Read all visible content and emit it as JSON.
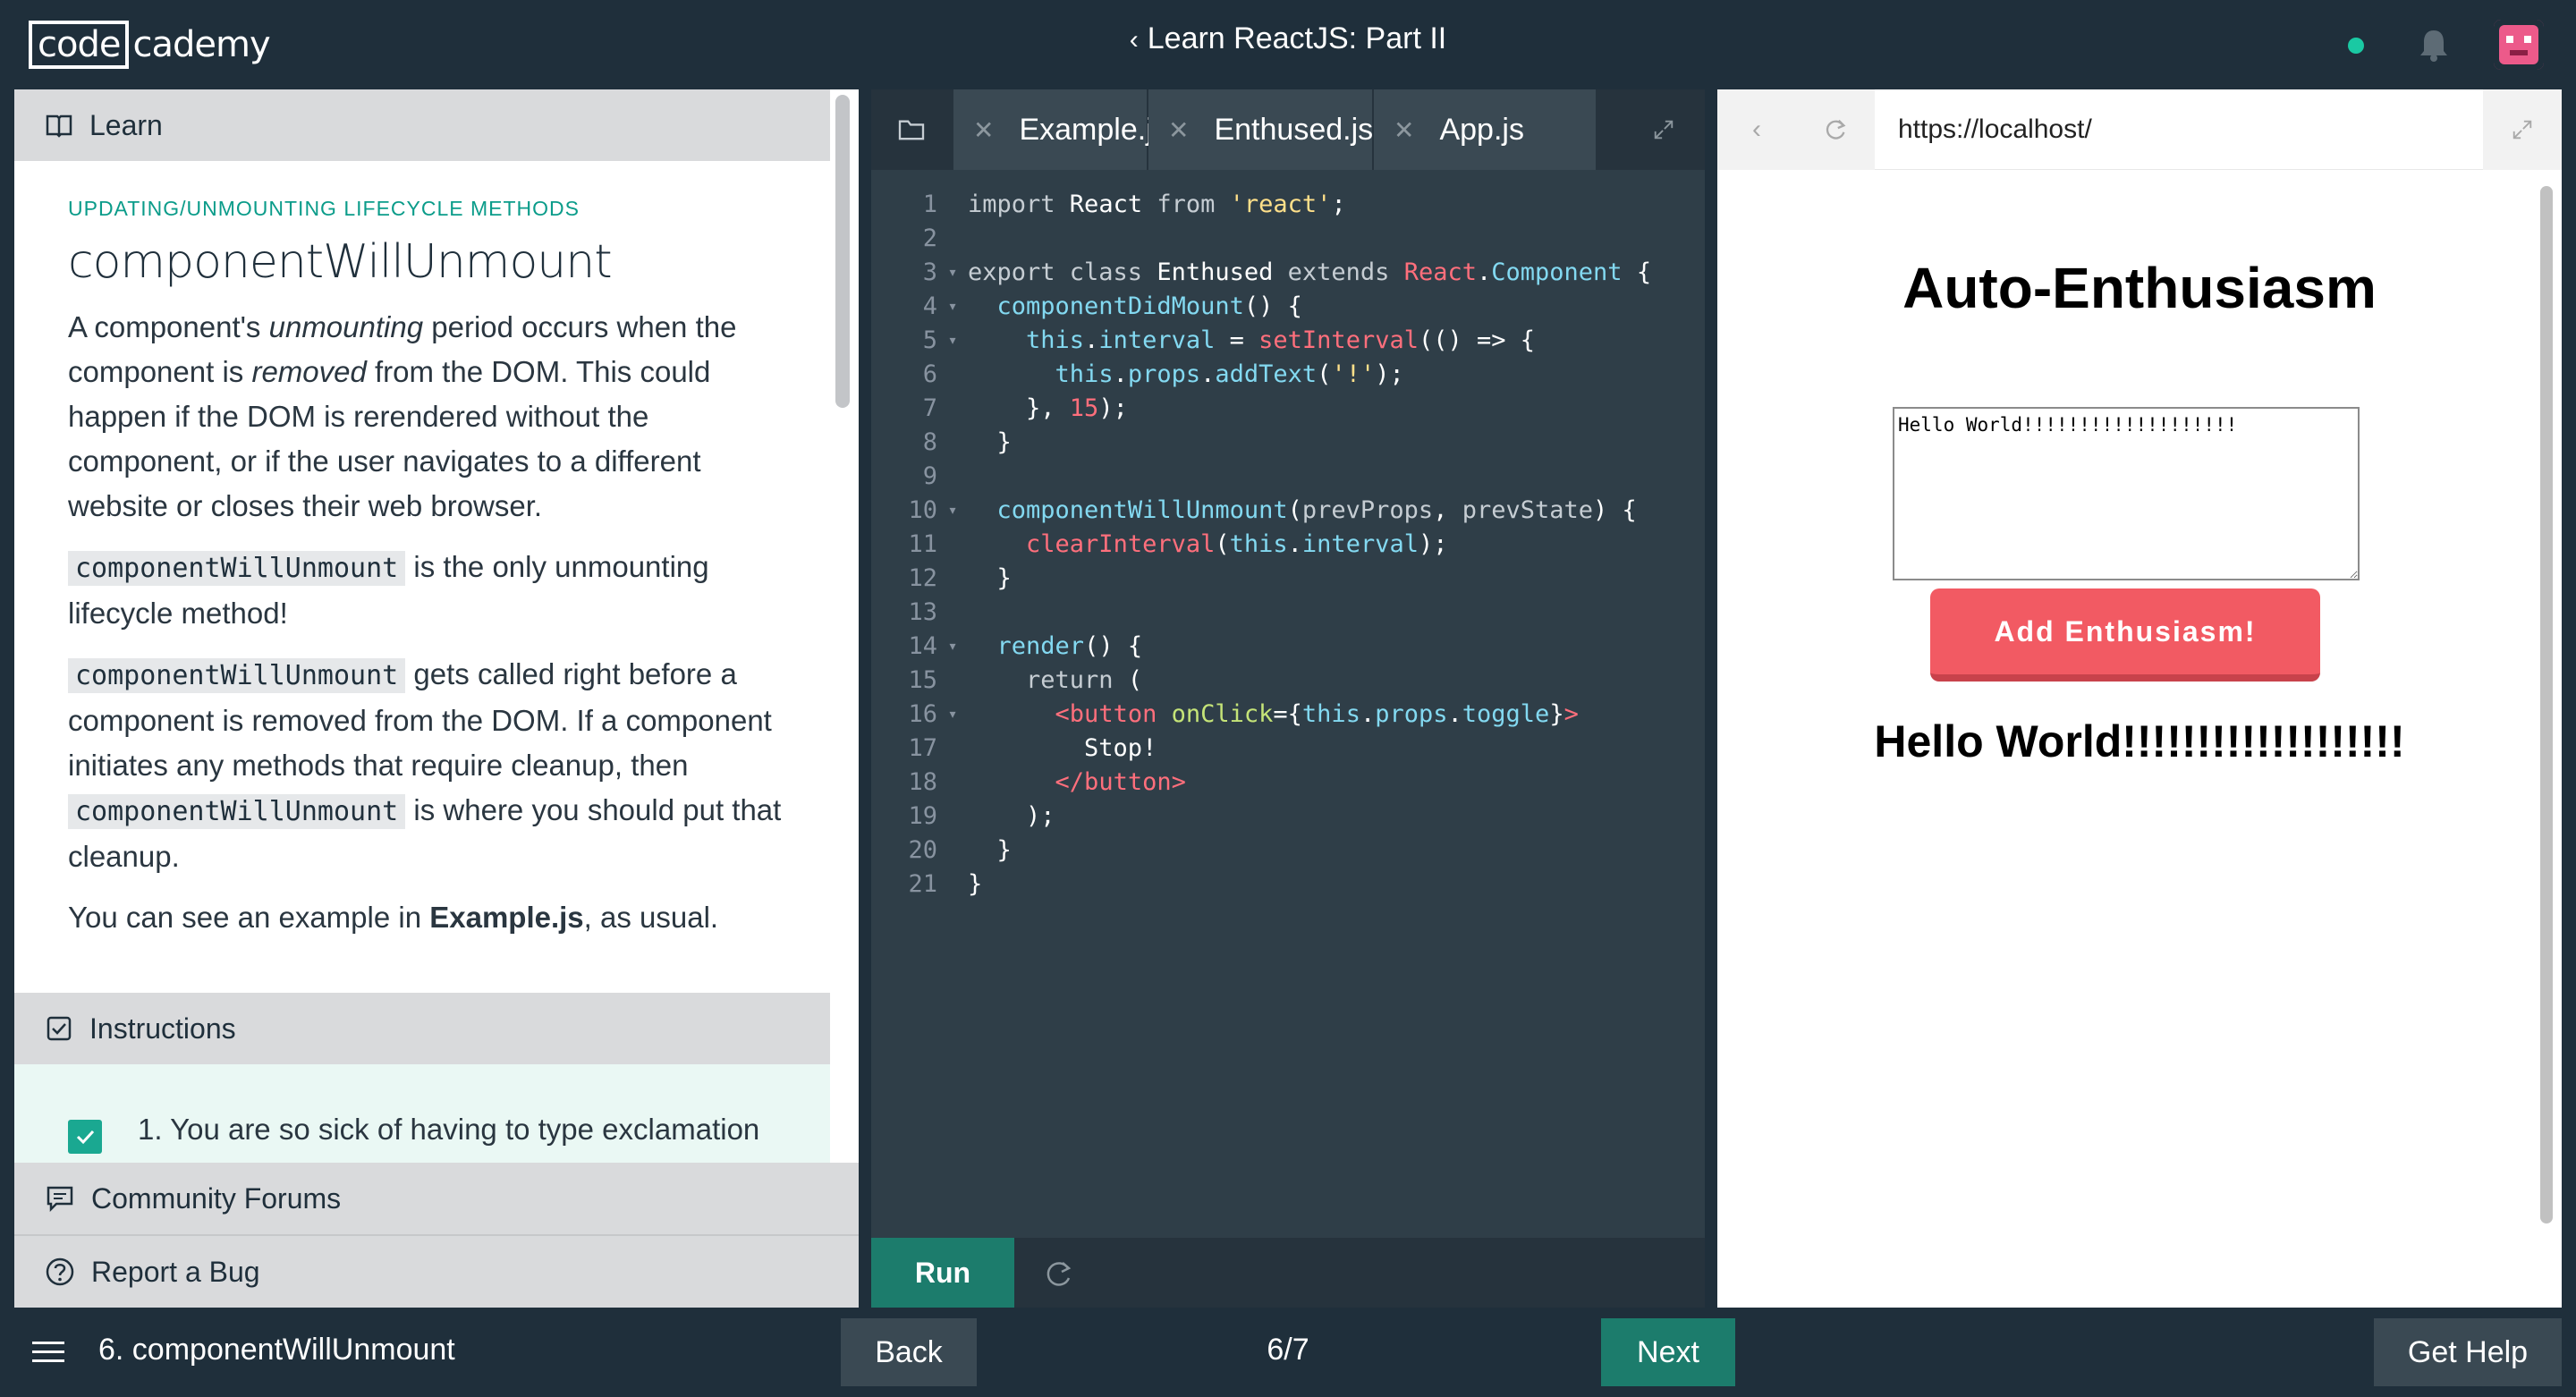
{
  "topbar": {
    "logo_part1": "code",
    "logo_part2": "cademy",
    "course_title": "Learn ReactJS: Part II",
    "status_color": "#1ac9a3"
  },
  "learn": {
    "header": "Learn",
    "kicker": "UPDATING/UNMOUNTING LIFECYCLE METHODS",
    "title": "componentWillUnmount",
    "p1": {
      "a": "A component's ",
      "em1": "unmounting",
      "b": " period occurs when the component is ",
      "em2": "removed",
      "c": " from the DOM. This could happen if the DOM is rerendered without the component, or if the user navigates to a different website or closes their web browser."
    },
    "p2": {
      "code": "componentWillUnmount",
      "text": " is the only unmounting lifecycle method!"
    },
    "p3": {
      "code1": "componentWillUnmount",
      "a": " gets called right before a component is removed from the DOM. If a component initiates any methods that require cleanup, then ",
      "code2": "componentWillUnmount",
      "b": " is where you should put that cleanup."
    },
    "p4": {
      "a": "You can see an example in ",
      "strong": "Example.js",
      "b": ", as usual."
    }
  },
  "instructions": {
    "header": "Instructions",
    "item_number": "1.",
    "item_text": "You are so sick of having to type exclamation"
  },
  "links": {
    "forums": "Community Forums",
    "bug": "Report a Bug"
  },
  "editor": {
    "tabs": [
      "Example.js",
      "Enthused.js",
      "App.js"
    ],
    "active_tab": "Enthused.js",
    "run_label": "Run",
    "lines": [
      "1",
      "2",
      "3",
      "4",
      "5",
      "6",
      "7",
      "8",
      "9",
      "10",
      "11",
      "12",
      "13",
      "14",
      "15",
      "16",
      "17",
      "18",
      "19",
      "20",
      "21"
    ]
  },
  "browser": {
    "url": "https://localhost/",
    "app_title": "Auto-Enthusiasm",
    "input_value": "Hello World!!!!!!!!!!!!!!!!!!!",
    "button_label": "Add Enthusiasm!",
    "output_text": "Hello World!!!!!!!!!!!!!!!!!!!"
  },
  "bottombar": {
    "lesson_name": "6. componentWillUnmount",
    "back_label": "Back",
    "progress": "6/7",
    "next_label": "Next",
    "help_label": "Get Help"
  },
  "colors": {
    "navy": "#1f2f3b",
    "teal": "#1c7c6c",
    "coral": "#f25a63"
  }
}
